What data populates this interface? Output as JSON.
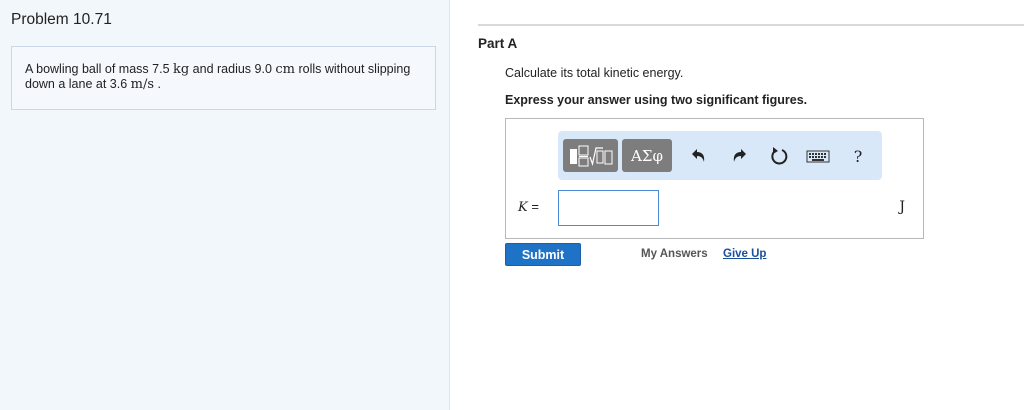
{
  "problem": {
    "title": "Problem 10.71",
    "text_parts": {
      "t1": "A bowling ball of mass 7.5 ",
      "u1": "kg",
      "t2": " and radius 9.0 ",
      "u2": "cm",
      "t3": " rolls without slipping down a lane at 3.6 ",
      "u3": "m/s",
      "t4": " ."
    }
  },
  "part": {
    "label": "Part A",
    "question": "Calculate its total kinetic energy.",
    "instruction": "Express your answer using two significant figures."
  },
  "toolbar": {
    "greek_label": "ΑΣφ",
    "help_label": "?"
  },
  "answer": {
    "variable": "K",
    "equals": " =",
    "value": "",
    "unit": "J"
  },
  "actions": {
    "submit_label": "Submit",
    "my_answers_label": "My Answers",
    "give_up_label": "Give Up"
  },
  "colors": {
    "left_panel_bg": "#f2f7fc",
    "toolbar_bg": "#d8e8f8",
    "submit_bg": "#1f73c7",
    "link": "#1a4f9c"
  },
  "icons": [
    "templates-icon",
    "greek-symbols-icon",
    "undo-icon",
    "redo-icon",
    "reset-icon",
    "keyboard-icon",
    "help-icon"
  ]
}
